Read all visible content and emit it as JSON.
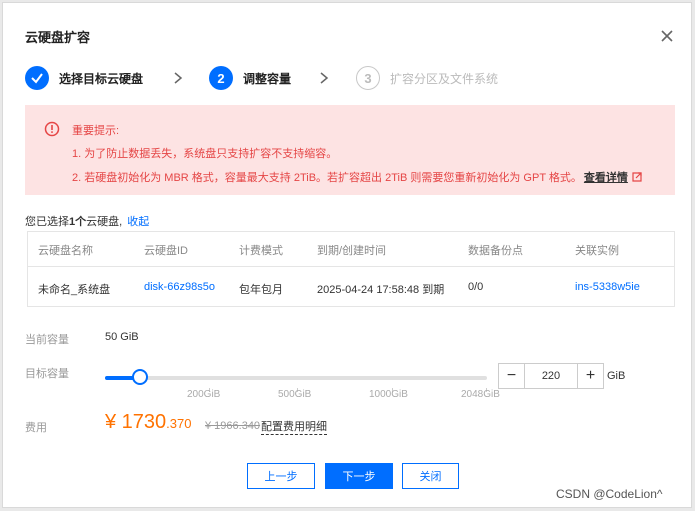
{
  "dialog": {
    "title": "云硬盘扩容",
    "steps": [
      {
        "index": "1",
        "label": "选择目标云硬盘",
        "state": "done"
      },
      {
        "index": "2",
        "label": "调整容量",
        "state": "active"
      },
      {
        "index": "3",
        "label": "扩容分区及文件系统",
        "state": "todo"
      }
    ],
    "alert": {
      "title": "重要提示:",
      "line1": "1. 为了防止数据丢失，系统盘只支持扩容不支持缩容。",
      "line2": "2. 若硬盘初始化为 MBR 格式，容量最大支持 2TiB。若扩容超出 2TiB 则需要您重新初始化为 GPT 格式。",
      "link": "查看详情"
    },
    "selection": {
      "prefix": "您已选择",
      "count": "1个",
      "suffix": "云硬盘,",
      "collapse": "收起"
    },
    "table": {
      "headers": [
        "云硬盘名称",
        "云硬盘ID",
        "计费模式",
        "到期/创建时间",
        "数据备份点",
        "关联实例"
      ],
      "row": {
        "name": "未命名_系统盘",
        "id": "disk-66z98s5o",
        "billing": "包年包月",
        "time": "2025-04-24 17:58:48 到期",
        "backup": "0/0",
        "instance": "ins-5338w5ie"
      }
    },
    "current_capacity": {
      "label": "当前容量",
      "value": "50 GiB"
    },
    "target_capacity": {
      "label": "目标容量",
      "value": "220",
      "unit": "GiB",
      "slider_fraction": 0.0917,
      "ticks": [
        "200GiB",
        "500GiB",
        "1000GiB",
        "2048GiB"
      ]
    },
    "fee": {
      "label": "费用",
      "price_main": "¥ 1730",
      "price_decimal": ".370",
      "original": "¥ 1966.340",
      "detail": "配置费用明细"
    },
    "buttons": {
      "prev": "上一步",
      "next": "下一步",
      "close": "关闭"
    },
    "colors": {
      "primary": "#006eff",
      "alert_bg": "#fde3e3",
      "alert_text": "#e54545",
      "price": "#ff7200"
    }
  },
  "watermark": "CSDN @CodeLion^"
}
